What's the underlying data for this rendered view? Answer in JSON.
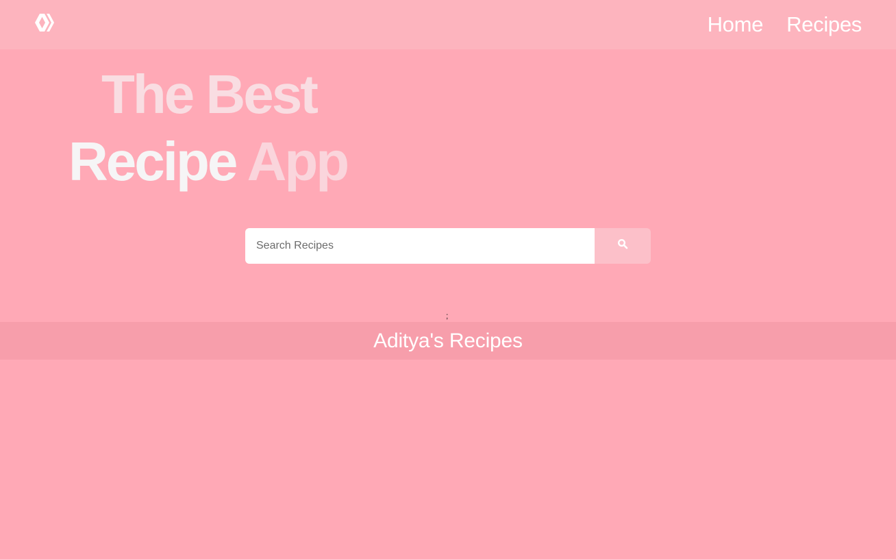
{
  "colors": {
    "background": "#ffa9b6",
    "navbar": "#fdb4be",
    "section_bar": "#f79eab",
    "search_button": "#fcc0c9"
  },
  "navbar": {
    "logo_icon": "double-chevron-logo-icon",
    "links": [
      {
        "label": "Home"
      },
      {
        "label": "Recipes"
      }
    ]
  },
  "hero": {
    "line1": "The Best",
    "line2_word1": "Recipe",
    "line2_word2": "App"
  },
  "search": {
    "placeholder": "Search Recipes",
    "button_icon": "search-icon"
  },
  "misc": {
    "stray_mark": ";"
  },
  "section": {
    "title": "Aditya's Recipes"
  }
}
